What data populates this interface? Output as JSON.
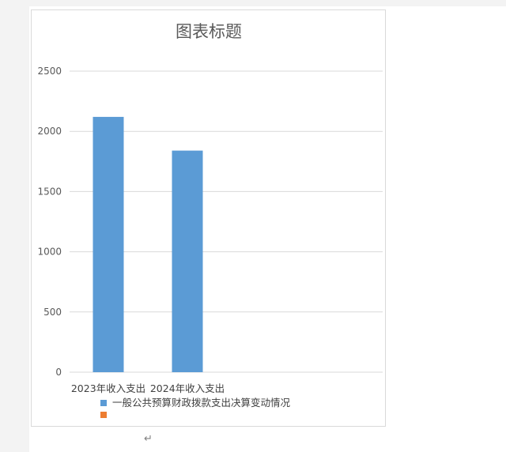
{
  "document": {
    "paragraph_mark": "↵"
  },
  "chart_data": {
    "type": "bar",
    "title": "图表标题",
    "categories": [
      "2023年收入支出",
      "2024年收入支出"
    ],
    "series": [
      {
        "name": "一般公共预算财政拨款支出决算变动情况",
        "values": [
          2120,
          1840
        ],
        "color": "#5b9bd5"
      },
      {
        "name": "",
        "values": [
          null,
          null
        ],
        "color": "#ed7d31"
      }
    ],
    "xlabel": "",
    "ylabel": "",
    "ylim": [
      0,
      2500
    ],
    "yticks": [
      0,
      500,
      1000,
      1500,
      2000,
      2500
    ],
    "grid": true,
    "legend_position": "bottom"
  }
}
